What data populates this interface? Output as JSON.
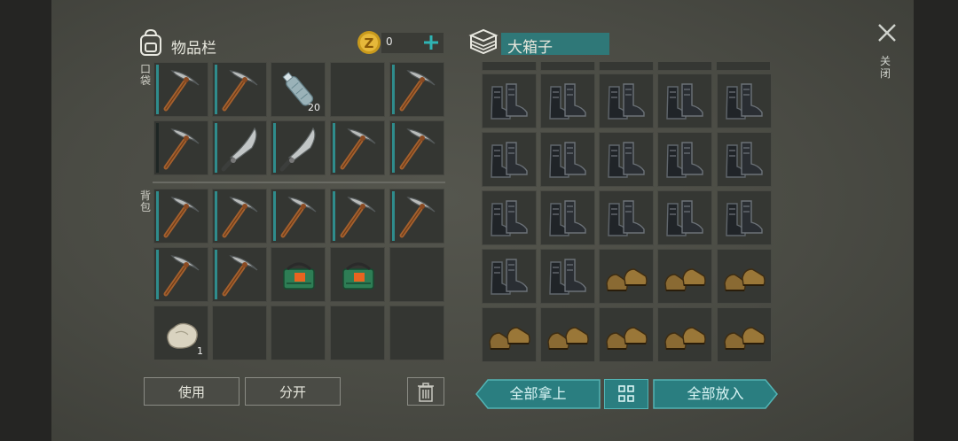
{
  "inventory": {
    "title": "物品栏",
    "coins": "0",
    "pocket_label": "口袋",
    "backpack_label": "背包"
  },
  "container": {
    "title": "大箱子"
  },
  "close_label": "关闭",
  "pocket_slots": [
    {
      "item": "pickaxe",
      "qty": ""
    },
    {
      "item": "pickaxe",
      "qty": ""
    },
    {
      "item": "water-bottle",
      "qty": "20"
    },
    {
      "item": "empty",
      "qty": ""
    },
    {
      "item": "pickaxe",
      "qty": ""
    },
    {
      "item": "pickaxe",
      "qty": ""
    },
    {
      "item": "machete",
      "qty": ""
    },
    {
      "item": "machete",
      "qty": ""
    },
    {
      "item": "pickaxe",
      "qty": ""
    },
    {
      "item": "pickaxe",
      "qty": ""
    }
  ],
  "backpack_slots": [
    {
      "item": "pickaxe",
      "qty": ""
    },
    {
      "item": "pickaxe",
      "qty": ""
    },
    {
      "item": "pickaxe",
      "qty": ""
    },
    {
      "item": "pickaxe",
      "qty": ""
    },
    {
      "item": "pickaxe",
      "qty": ""
    },
    {
      "item": "pickaxe",
      "qty": ""
    },
    {
      "item": "pickaxe",
      "qty": ""
    },
    {
      "item": "supply-box",
      "qty": ""
    },
    {
      "item": "supply-box",
      "qty": ""
    },
    {
      "item": "empty",
      "qty": ""
    },
    {
      "item": "stone",
      "qty": "1"
    },
    {
      "item": "empty",
      "qty": ""
    },
    {
      "item": "empty",
      "qty": ""
    },
    {
      "item": "empty",
      "qty": ""
    },
    {
      "item": "empty",
      "qty": ""
    }
  ],
  "chest_slots": [
    "black-boots",
    "black-boots",
    "black-boots",
    "black-boots",
    "black-boots",
    "black-boots",
    "black-boots",
    "black-boots",
    "black-boots",
    "black-boots",
    "black-boots",
    "black-boots",
    "black-boots",
    "black-boots",
    "black-boots",
    "black-boots",
    "black-boots",
    "brown-shoes",
    "brown-shoes",
    "brown-shoes",
    "brown-shoes",
    "brown-shoes",
    "brown-shoes",
    "brown-shoes",
    "brown-shoes"
  ],
  "buttons": {
    "use": "使用",
    "split": "分开",
    "take_all": "全部拿上",
    "put_all": "全部放入"
  },
  "colors": {
    "accent_teal": "#2f8c8c",
    "panel": "#4a4b44"
  }
}
